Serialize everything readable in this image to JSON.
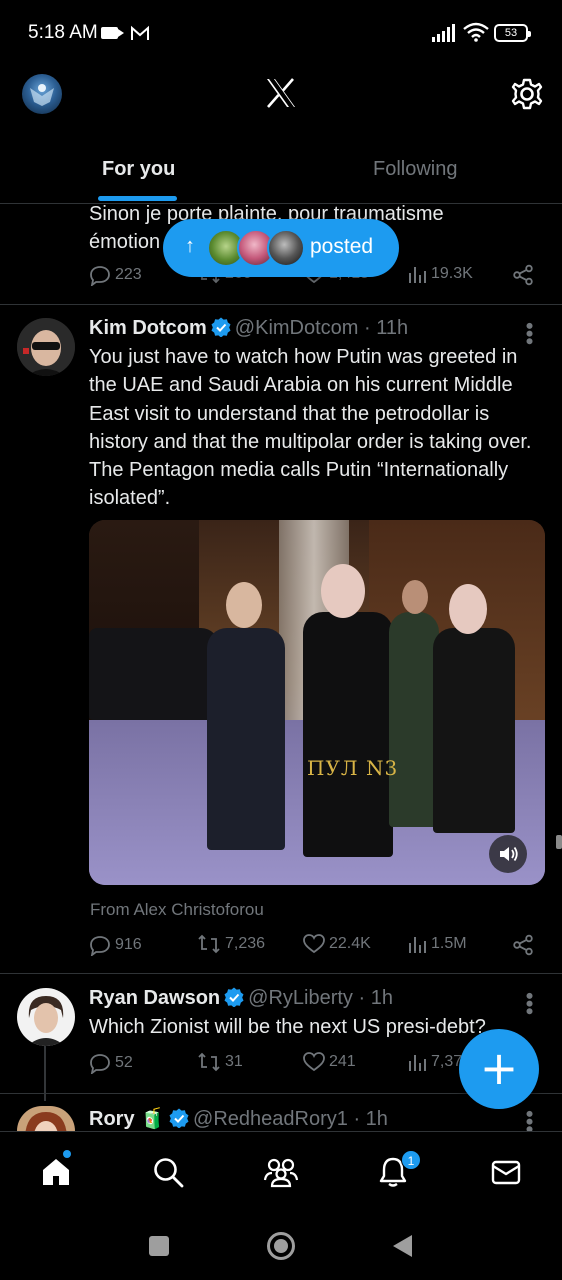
{
  "status_bar": {
    "time": "5:18 AM",
    "battery": "53"
  },
  "tabs": [
    {
      "label": "For you",
      "active": true
    },
    {
      "label": "Following",
      "active": false
    }
  ],
  "prev_tweet": {
    "text_line1": "Sinon je porte plainte, pour traumatisme",
    "text_line2": "émotion",
    "replies": "223",
    "retweets": "260",
    "likes": "1,415",
    "views": "19.3K"
  },
  "posted_pill": {
    "label": "posted"
  },
  "tweet_main": {
    "name": "Kim Dotcom",
    "handle": "@KimDotcom",
    "time": "11h",
    "text": "You just have to watch how Putin was greeted in the UAE and Saudi Arabia on his current Middle East visit to understand that the petrodollar is history and that the multipolar order is taking over. The Pentagon media calls Putin “Internationally isolated”.",
    "media_watermark": "ПУЛ N3",
    "from": "From Alex Christoforou",
    "replies": "916",
    "retweets": "7,236",
    "likes": "22.4K",
    "views": "1.5M"
  },
  "tweet_second": {
    "name": "Ryan Dawson",
    "handle": "@RyLiberty",
    "time": "1h",
    "text": "Which Zionist will be the next US presi-debt?",
    "replies": "52",
    "retweets": "31",
    "likes": "241",
    "views": "7,37"
  },
  "tweet_third": {
    "name": "Rory",
    "emoji": "🧃",
    "handle": "@RedheadRory1",
    "time": "1h"
  },
  "bottom_nav": {
    "notifications_badge": "1"
  },
  "colors": {
    "accent": "#1d9bf0",
    "background": "#000000",
    "muted": "#71767b",
    "divider": "#2f3336"
  },
  "icons": [
    "camera-icon",
    "gmail-icon",
    "signal-icon",
    "wifi-icon",
    "battery-icon",
    "x-logo-icon",
    "gear-icon",
    "reply-icon",
    "retweet-icon",
    "like-icon",
    "views-icon",
    "share-icon",
    "verified-icon",
    "more-icon",
    "sound-icon",
    "plus-icon",
    "home-icon",
    "search-icon",
    "communities-icon",
    "bell-icon",
    "mail-icon"
  ]
}
